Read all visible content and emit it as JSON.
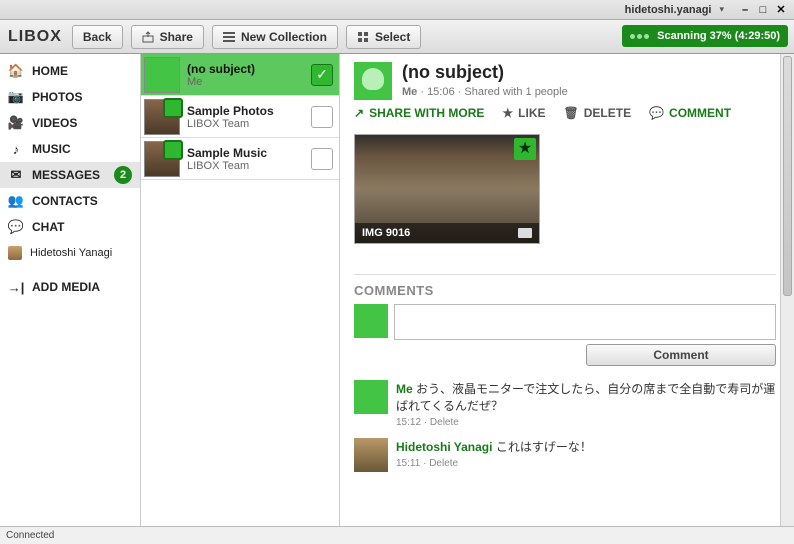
{
  "titlebar": {
    "user": "hidetoshi.yanagi"
  },
  "toolbar": {
    "logo": "LIBOX",
    "back": "Back",
    "share": "Share",
    "new_collection": "New Collection",
    "select": "Select",
    "scan_label": "Scanning 37% (4:29:50)"
  },
  "sidebar": {
    "items": [
      {
        "label": "HOME"
      },
      {
        "label": "PHOTOS"
      },
      {
        "label": "VIDEOS"
      },
      {
        "label": "MUSIC"
      },
      {
        "label": "MESSAGES",
        "badge": "2"
      },
      {
        "label": "CONTACTS"
      },
      {
        "label": "CHAT"
      },
      {
        "label": "Hidetoshi Yanagi"
      },
      {
        "label": "ADD MEDIA"
      }
    ]
  },
  "list": {
    "items": [
      {
        "title": "(no subject)",
        "sub": "Me",
        "checked": true
      },
      {
        "title": "Sample Photos",
        "sub": "LIBOX Team",
        "checked": false
      },
      {
        "title": "Sample Music",
        "sub": "LIBOX Team",
        "checked": false
      }
    ]
  },
  "post": {
    "title": "(no subject)",
    "author": "Me",
    "time": "15:06",
    "shared_with": "Shared with 1 people",
    "actions": {
      "share": "SHARE WITH MORE",
      "like": "LIKE",
      "delete": "DELETE",
      "comment": "COMMENT"
    },
    "image_caption": "IMG 9016",
    "comments_header": "COMMENTS",
    "comment_button": "Comment",
    "comments": [
      {
        "author": "Me",
        "text": "おう、液晶モニターで注文したら、自分の席まで全自動で寿司が運ばれてくるんだぜ？",
        "time": "15:12",
        "delete": "Delete"
      },
      {
        "author": "Hidetoshi Yanagi",
        "text": "これはすげーな！",
        "time": "15:11",
        "delete": "Delete"
      }
    ]
  },
  "status": {
    "text": "Connected"
  }
}
